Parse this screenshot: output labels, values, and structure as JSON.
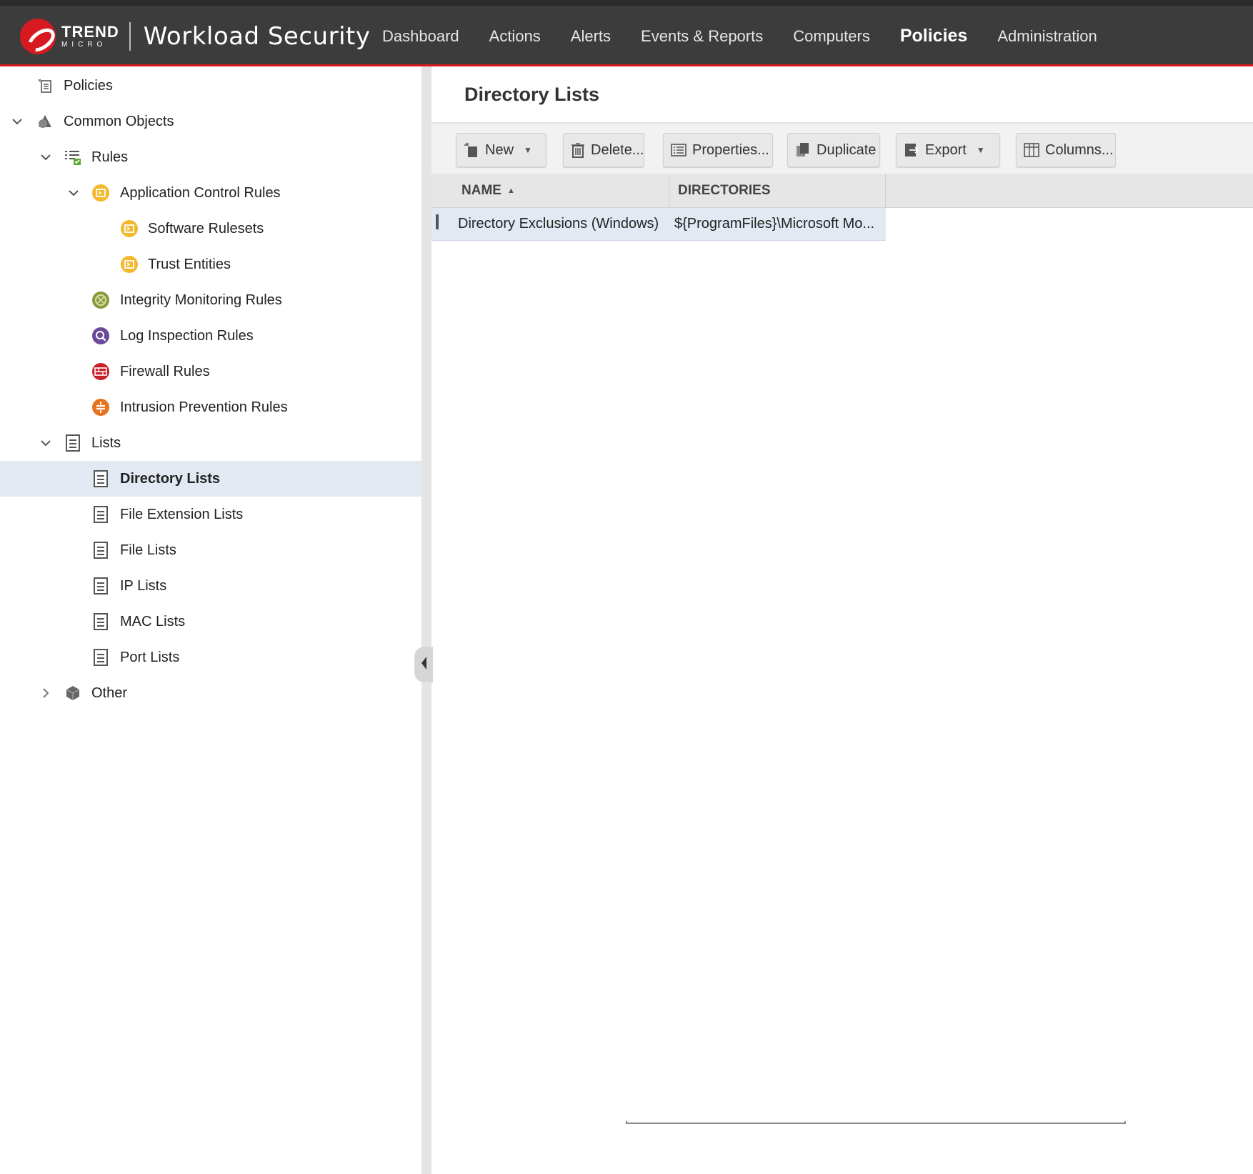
{
  "brand": {
    "logo_top": "TREND",
    "logo_bottom": "MICRO",
    "product": "Workload Security",
    "accent_color": "#d71920"
  },
  "nav": {
    "items": [
      {
        "label": "Dashboard"
      },
      {
        "label": "Actions"
      },
      {
        "label": "Alerts"
      },
      {
        "label": "Events & Reports"
      },
      {
        "label": "Computers"
      },
      {
        "label": "Policies",
        "active": true
      },
      {
        "label": "Administration"
      }
    ]
  },
  "sidebar": {
    "items": [
      {
        "label": "Policies",
        "icon": "policies-icon"
      },
      {
        "label": "Common Objects",
        "icon": "common-objects-icon",
        "expanded": true
      },
      {
        "label": "Rules",
        "icon": "rules-icon",
        "expanded": true
      },
      {
        "label": "Application Control Rules",
        "icon": "application-control-icon",
        "expanded": true
      },
      {
        "label": "Software Rulesets",
        "icon": "application-control-icon"
      },
      {
        "label": "Trust Entities",
        "icon": "application-control-icon"
      },
      {
        "label": "Integrity Monitoring Rules",
        "icon": "integrity-monitoring-icon"
      },
      {
        "label": "Log Inspection Rules",
        "icon": "log-inspection-icon"
      },
      {
        "label": "Firewall Rules",
        "icon": "firewall-icon"
      },
      {
        "label": "Intrusion Prevention Rules",
        "icon": "intrusion-prevention-icon"
      },
      {
        "label": "Lists",
        "icon": "list-icon",
        "expanded": true
      },
      {
        "label": "Directory Lists",
        "icon": "list-icon",
        "selected": true
      },
      {
        "label": "File Extension Lists",
        "icon": "list-icon"
      },
      {
        "label": "File Lists",
        "icon": "list-icon"
      },
      {
        "label": "IP Lists",
        "icon": "list-icon"
      },
      {
        "label": "MAC Lists",
        "icon": "list-icon"
      },
      {
        "label": "Port Lists",
        "icon": "list-icon"
      },
      {
        "label": "Other",
        "icon": "cube-icon",
        "expanded": false
      }
    ]
  },
  "main": {
    "title": "Directory Lists",
    "toolbar": {
      "new_label": "New",
      "delete_label": "Delete...",
      "properties_label": "Properties...",
      "duplicate_label": "Duplicate",
      "export_label": "Export",
      "columns_label": "Columns..."
    },
    "table": {
      "columns": [
        "NAME",
        "DIRECTORIES"
      ],
      "sort_indicator": "▲",
      "rows": [
        {
          "name": "Directory Exclusions (Windows)",
          "directories": "${ProgramFiles}\\Microsoft Mo..."
        }
      ]
    }
  }
}
